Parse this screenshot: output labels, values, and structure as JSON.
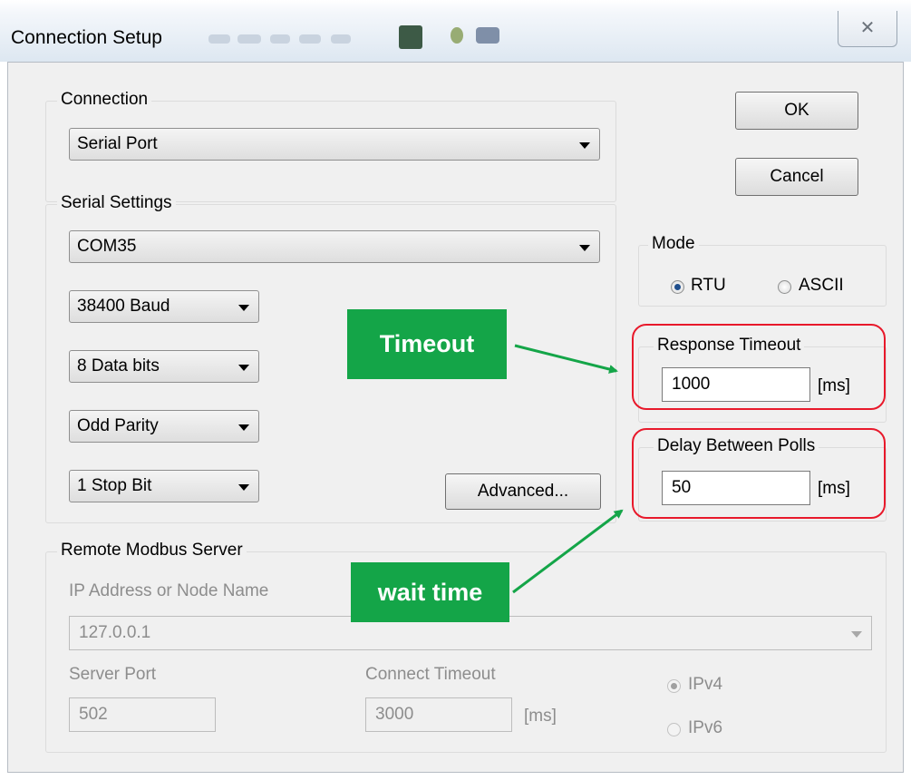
{
  "window": {
    "title": "Connection Setup",
    "close_glyph": "✕"
  },
  "buttons": {
    "ok": "OK",
    "cancel": "Cancel",
    "advanced": "Advanced..."
  },
  "connection": {
    "group_label": "Connection",
    "selected": "Serial Port"
  },
  "serial": {
    "group_label": "Serial Settings",
    "port": "COM35",
    "baud": "38400 Baud",
    "data_bits": "8 Data bits",
    "parity": "Odd Parity",
    "stop_bits": "1 Stop Bit"
  },
  "mode": {
    "group_label": "Mode",
    "options": [
      {
        "label": "RTU",
        "checked": true
      },
      {
        "label": "ASCII",
        "checked": false
      }
    ]
  },
  "response_timeout": {
    "group_label": "Response Timeout",
    "value": "1000",
    "unit": "[ms]"
  },
  "delay_between_polls": {
    "group_label": "Delay Between Polls",
    "value": "50",
    "unit": "[ms]"
  },
  "remote": {
    "group_label": "Remote Modbus Server",
    "ip_label": "IP Address or Node Name",
    "ip_value": "127.0.0.1",
    "port_label": "Server Port",
    "port_value": "502",
    "connect_timeout_label": "Connect Timeout",
    "connect_timeout_value": "3000",
    "connect_timeout_unit": "[ms]",
    "ip_versions": [
      {
        "label": "IPv4",
        "checked": true
      },
      {
        "label": "IPv6",
        "checked": false
      }
    ]
  },
  "annotations": {
    "timeout_callout": "Timeout",
    "wait_time_callout": "wait time",
    "highlight_color": "#e8192b",
    "callout_color": "#14a548"
  }
}
